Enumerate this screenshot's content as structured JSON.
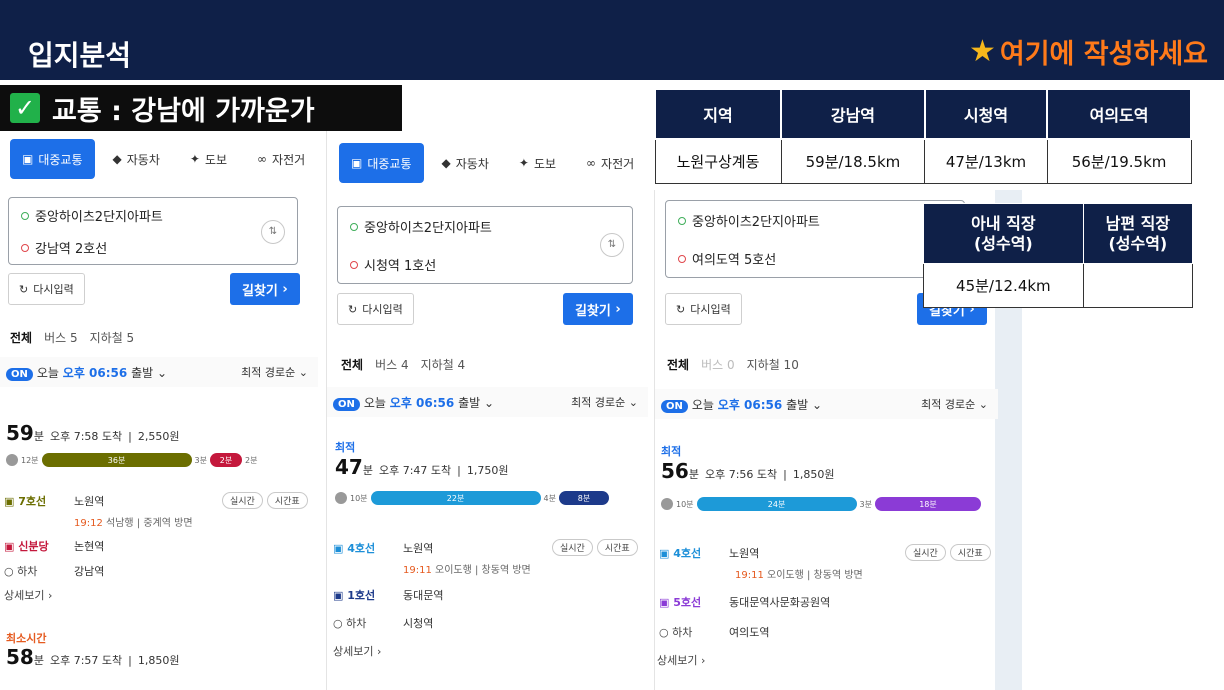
{
  "header": {
    "title": "입지분석",
    "write_here": "여기에 작성하세요"
  },
  "section": {
    "title": "교통 : 강남에 가까운가"
  },
  "tabs": [
    "대중교통",
    "자동차",
    "도보",
    "자전거"
  ],
  "common": {
    "reset": "다시입력",
    "find": "길찾기",
    "sort": "최적 경로순",
    "depart_prefix": "오늘",
    "depart_time": "오후 06:56",
    "depart_suffix": "출발",
    "on_badge": "ON",
    "realtime": "실시간",
    "timetable": "시간표",
    "more": "상세보기",
    "best": "최적",
    "min_unit": "분",
    "all": "전체"
  },
  "panel1": {
    "origin": "중앙하이츠2단지아파트",
    "dest": "강남역 2호선",
    "filter_bus": "버스 5",
    "filter_subway": "지하철 5",
    "minutes": "59",
    "arrive": "오후 7:58 도착",
    "fare": "2,550원",
    "bar": {
      "walk": "12분",
      "main": "36분",
      "mid": "3분",
      "end": "2분",
      "tail": "2분"
    },
    "steps": [
      {
        "line": "7호선",
        "station": "노원역",
        "color": "#6b6e00"
      },
      {
        "line": "신분당",
        "station": "논현역",
        "color": "#c4183c"
      },
      {
        "line": "하차",
        "station": "강남역",
        "color": "#444444"
      }
    ],
    "sub_time": "19:12",
    "sub_desc": "석남행 | 중계역 방면",
    "second_label": "최소시간",
    "second_minutes": "58",
    "second_arrive": "오후 7:57 도착",
    "second_fare": "1,850원"
  },
  "panel2": {
    "origin": "중앙하이츠2단지아파트",
    "dest": "시청역 1호선",
    "filter_bus": "버스 4",
    "filter_subway": "지하철 4",
    "minutes": "47",
    "arrive": "오후 7:47 도착",
    "fare": "1,750원",
    "bar": {
      "walk": "10분",
      "main": "22분",
      "mid": "4분",
      "end": "8분"
    },
    "steps": [
      {
        "line": "4호선",
        "station": "노원역",
        "color": "#1d8fd8"
      },
      {
        "line": "1호선",
        "station": "동대문역",
        "color": "#1d3a8a"
      },
      {
        "line": "하차",
        "station": "시청역",
        "color": "#444444"
      }
    ],
    "sub_time": "19:11",
    "sub_desc": "오이도행 | 창동역 방면"
  },
  "panel3": {
    "origin": "중앙하이츠2단지아파트",
    "dest": "여의도역 5호선",
    "filter_bus": "버스 0",
    "filter_subway": "지하철 10",
    "minutes": "56",
    "arrive": "오후 7:56 도착",
    "fare": "1,850원",
    "bar": {
      "walk": "10분",
      "main": "24분",
      "mid": "3분",
      "end": "18분"
    },
    "steps": [
      {
        "line": "4호선",
        "station": "노원역",
        "color": "#1d8fd8"
      },
      {
        "line": "5호선",
        "station": "동대문역사문화공원역",
        "color": "#8b3bd6"
      },
      {
        "line": "하차",
        "station": "여의도역",
        "color": "#444444"
      }
    ],
    "sub_time": "19:11",
    "sub_desc": "오이도행 | 창동역 방면"
  },
  "table1": {
    "headers": [
      "지역",
      "강남역",
      "시청역",
      "여의도역"
    ],
    "row": [
      "노원구상계동",
      "59분/18.5km",
      "47분/13km",
      "56분/19.5km"
    ]
  },
  "table2": {
    "headers": [
      "아내 직장\n(성수역)",
      "남편 직장\n(성수역)"
    ],
    "row": [
      "45분/12.4km",
      ""
    ]
  },
  "colors": {
    "header": "#0f2048",
    "accent": "#ff7a1a",
    "blue": "#1d6fe8"
  }
}
